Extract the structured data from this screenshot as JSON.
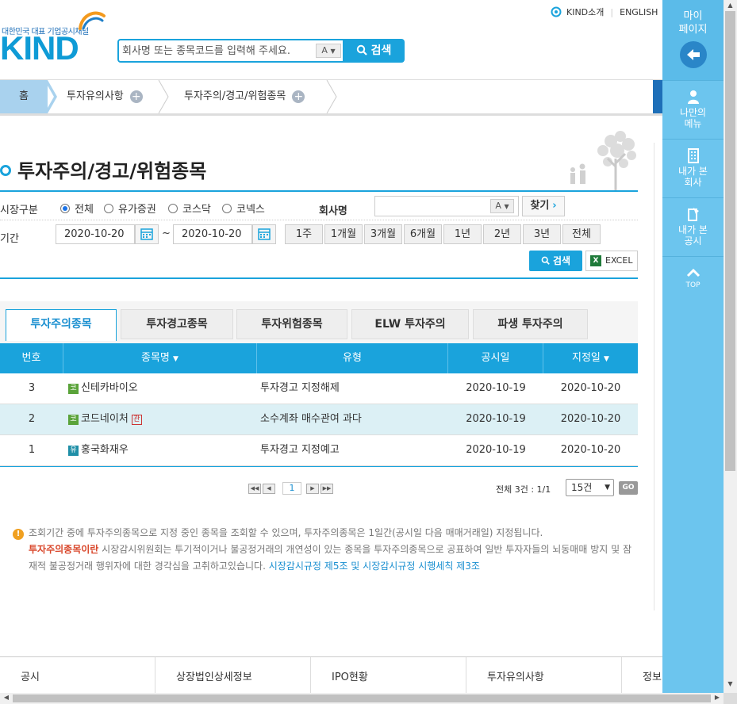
{
  "header": {
    "logo_tagline": "대한민국 대표 기업공시채널",
    "logo_text": "KIND",
    "search_placeholder": "회사명 또는 종목코드를 입력해 주세요.",
    "kbd_toggle": "A",
    "search_button": "검색",
    "link_about": "KIND소개",
    "link_english": "ENGLISH"
  },
  "breadcrumb": {
    "home": "홈",
    "items": [
      "투자유의사항",
      "투자주의/경고/위험종목"
    ]
  },
  "page": {
    "title": "투자주의/경고/위험종목"
  },
  "filters": {
    "market_label": "시장구분",
    "market_options": [
      "전체",
      "유가증권",
      "코스닥",
      "코넥스"
    ],
    "market_selected": "전체",
    "company_label": "회사명",
    "company_value": "",
    "company_kbd": "A",
    "find_button": "찾기",
    "period_label": "기간",
    "date_from": "2020-10-20",
    "date_sep": "~",
    "date_to": "2020-10-20",
    "period_buttons": [
      "1주",
      "1개월",
      "3개월",
      "6개월",
      "1년",
      "2년",
      "3년",
      "전체"
    ],
    "search_button": "검색",
    "excel_button": "EXCEL"
  },
  "tabs": [
    "투자주의종목",
    "투자경고종목",
    "투자위험종목",
    "ELW 투자주의",
    "파생 투자주의"
  ],
  "active_tab": "투자주의종목",
  "table": {
    "headers": [
      "번호",
      "종목명",
      "유형",
      "공시일",
      "지정일"
    ],
    "rows": [
      {
        "no": "3",
        "market_badge": "코",
        "name": "신테카바이오",
        "flag": "",
        "type": "투자경고 지정해제",
        "disclosed": "2020-10-19",
        "designated": "2020-10-20"
      },
      {
        "no": "2",
        "market_badge": "코",
        "name": "코드네이처",
        "flag": "관",
        "type": "소수계좌 매수관여 과다",
        "disclosed": "2020-10-19",
        "designated": "2020-10-20"
      },
      {
        "no": "1",
        "market_badge": "유",
        "name": "홍국화재우",
        "flag": "",
        "type": "투자경고 지정예고",
        "disclosed": "2020-10-19",
        "designated": "2020-10-20"
      }
    ]
  },
  "pager": {
    "current_page": "1",
    "summary": "전체 3건 : 1/1",
    "page_size": "15건",
    "go_button": "GO"
  },
  "notice": {
    "line1": "조회기간 중에 투자주의종목으로 지정 중인 종목을 조회할 수 있으며, 투자주의종목은 1일간(공시일 다음 매매거래일) 지정됩니다.",
    "term": "투자주의종목이란",
    "definition": "시장감시위원회는 투기적이거나 불공정거래의 개연성이 있는 종목을 투자주의종목으로 공표하여 일반 투자자들의 뇌동매매 방지 및 잠재적 불공정거래 행위자에 대한 경각심을 고취하고있습니다.",
    "rule_link": "시장감시규정 제5조 및 시장감시규정 시행세칙 제3조"
  },
  "footer": {
    "items": [
      "공시",
      "상장법인상세정보",
      "IPO현황",
      "투자유의사항",
      "정보"
    ]
  },
  "right_panel": {
    "title": "마이\n페이지",
    "items": [
      "나만의\n메뉴",
      "내가 본\n회사",
      "내가 본\n공시"
    ],
    "top_label": "TOP"
  }
}
